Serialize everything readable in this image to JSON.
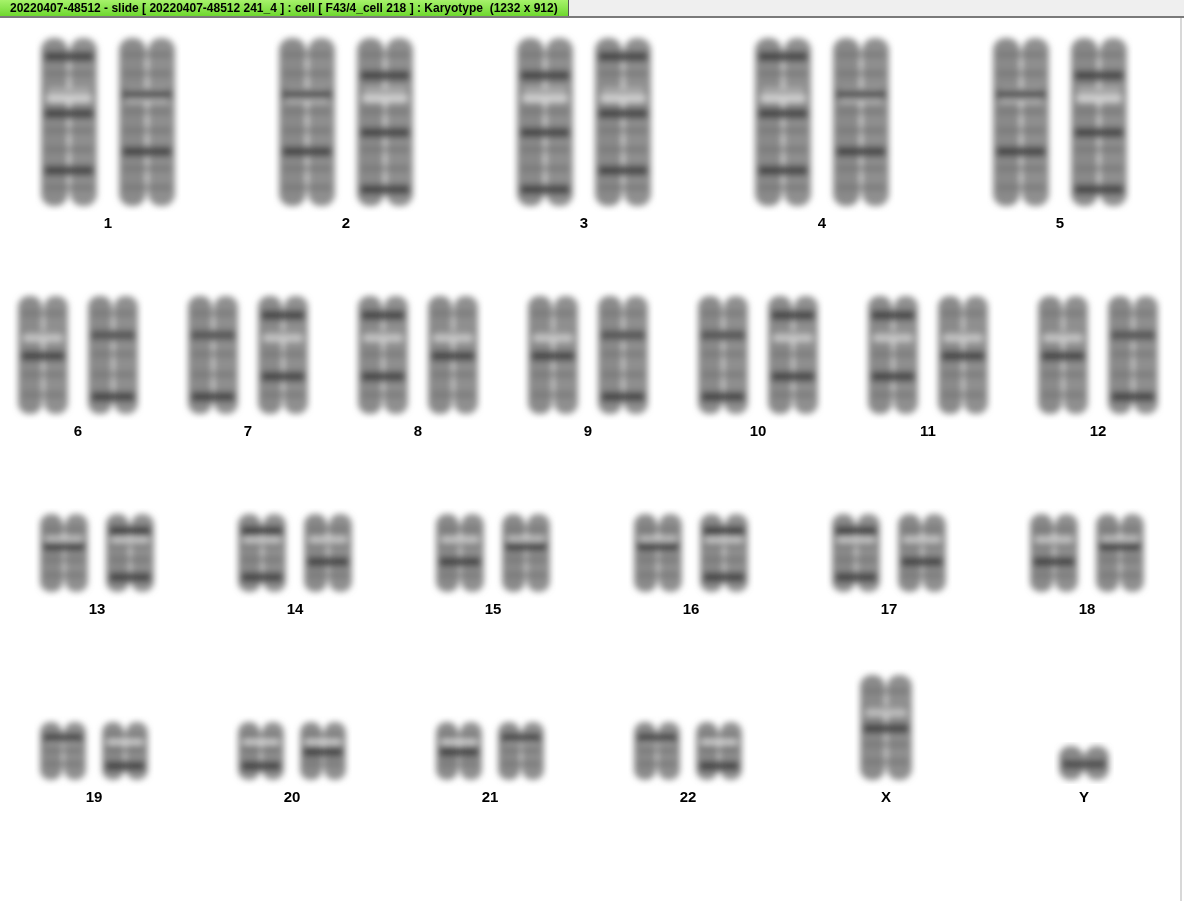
{
  "window": {
    "title": "20220407-48512 - slide [ 20220407-48512 241_4 ] : cell [ F43/4_cell 218 ] : Karyotype  (1232 x 912)"
  },
  "karyotype": {
    "rows": [
      {
        "groups": [
          {
            "label": "1",
            "kind": "pair"
          },
          {
            "label": "2",
            "kind": "pair"
          },
          {
            "label": "3",
            "kind": "pair"
          },
          {
            "label": "4",
            "kind": "pair"
          },
          {
            "label": "5",
            "kind": "pair"
          }
        ]
      },
      {
        "groups": [
          {
            "label": "6",
            "kind": "pair"
          },
          {
            "label": "7",
            "kind": "pair"
          },
          {
            "label": "8",
            "kind": "pair"
          },
          {
            "label": "9",
            "kind": "pair"
          },
          {
            "label": "10",
            "kind": "pair"
          },
          {
            "label": "11",
            "kind": "pair"
          },
          {
            "label": "12",
            "kind": "pair"
          }
        ]
      },
      {
        "groups": [
          {
            "label": "13",
            "kind": "pair"
          },
          {
            "label": "14",
            "kind": "pair"
          },
          {
            "label": "15",
            "kind": "pair"
          },
          {
            "label": "16",
            "kind": "pair"
          },
          {
            "label": "17",
            "kind": "pair"
          },
          {
            "label": "18",
            "kind": "pair"
          }
        ]
      },
      {
        "groups": [
          {
            "label": "19",
            "kind": "pair"
          },
          {
            "label": "20",
            "kind": "pair"
          },
          {
            "label": "21",
            "kind": "pair"
          },
          {
            "label": "22",
            "kind": "pair"
          },
          {
            "label": "X",
            "kind": "single"
          },
          {
            "label": "Y",
            "kind": "single"
          }
        ]
      }
    ]
  }
}
